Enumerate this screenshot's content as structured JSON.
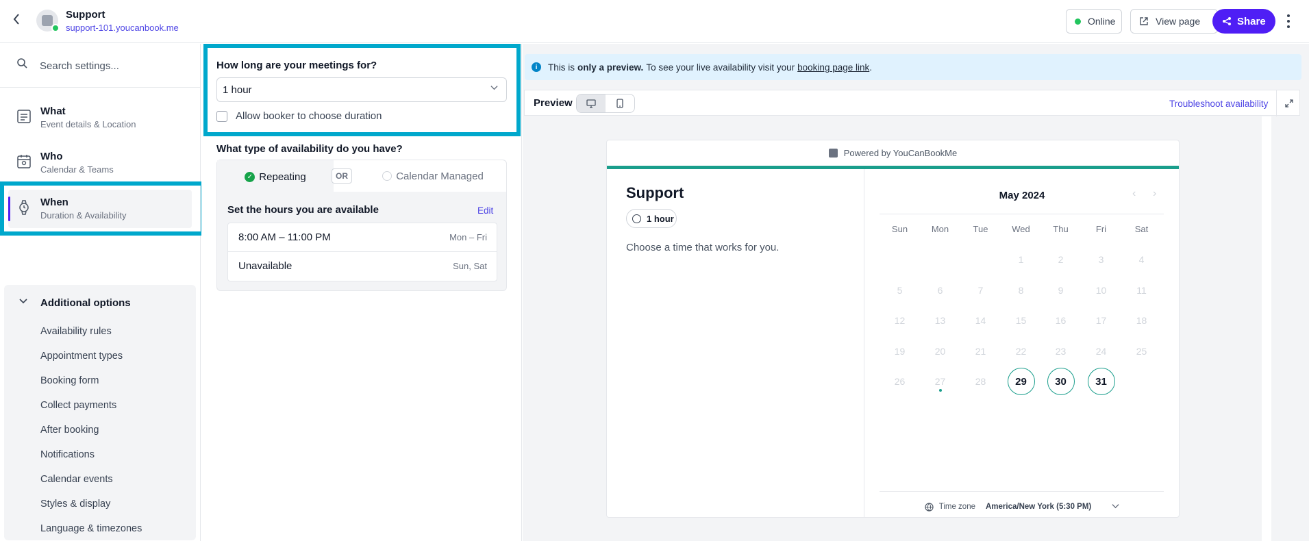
{
  "header": {
    "title": "Support",
    "subtitle": "support-101.youcanbook.me",
    "status": "Online",
    "view_page": "View page",
    "share": "Share"
  },
  "sidebar": {
    "search_placeholder": "Search settings...",
    "items": [
      {
        "title": "What",
        "sub": "Event details & Location",
        "icon": "event-details-icon"
      },
      {
        "title": "Who",
        "sub": "Calendar & Teams",
        "icon": "calendar-team-icon"
      },
      {
        "title": "When",
        "sub": "Duration & Availability",
        "icon": "watch-icon"
      }
    ],
    "additional": {
      "heading": "Additional options",
      "items": [
        "Availability rules",
        "Appointment types",
        "Booking form",
        "Collect payments",
        "After booking",
        "Notifications",
        "Calendar events",
        "Styles & display",
        "Language & timezones"
      ]
    }
  },
  "settings": {
    "duration_question": "How long are your meetings for?",
    "duration_value": "1 hour",
    "allow_choose": "Allow booker to choose duration",
    "availability_question": "What type of availability do you have?",
    "type_repeating": "Repeating",
    "type_or": "OR",
    "type_managed": "Calendar Managed",
    "set_hours": "Set the hours you are available",
    "edit": "Edit",
    "hours": [
      {
        "time": "8:00 AM – 11:00 PM",
        "days": "Mon – Fri"
      },
      {
        "time": "Unavailable",
        "days": "Sun, Sat"
      }
    ]
  },
  "preview": {
    "info_prefix": "This is",
    "info_bold": "only a preview.",
    "info_mid": "To see your live availability visit your",
    "info_link": "booking page link",
    "info_end": ".",
    "label": "Preview",
    "troubleshoot": "Troubleshoot availability",
    "powered": "Powered by YouCanBookMe",
    "title": "Support",
    "duration": "1 hour",
    "choose": "Choose a time that works for you.",
    "month": "May 2024",
    "weekdays": [
      "Sun",
      "Mon",
      "Tue",
      "Wed",
      "Thu",
      "Fri",
      "Sat"
    ],
    "first_weekday_index": 3,
    "days_in_month": 31,
    "available_days": [
      29,
      30,
      31
    ],
    "today": 27,
    "timezone_label": "Time zone",
    "timezone_value": "America/New York (5:30 PM)"
  },
  "colors": {
    "accent": "#4f1ef5",
    "highlight": "#00a8cc",
    "teal": "#1a9e8c",
    "online": "#22c55e"
  }
}
